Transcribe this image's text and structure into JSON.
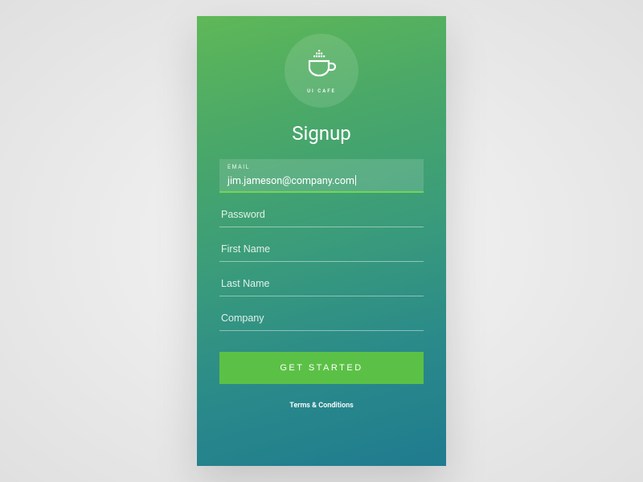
{
  "brand": "UI CAFÉ",
  "title": "Signup",
  "form": {
    "email": {
      "label": "EMAIL",
      "value": "jim.jameson@company.com"
    },
    "password": {
      "placeholder": "Password"
    },
    "first_name": {
      "placeholder": "First Name"
    },
    "last_name": {
      "placeholder": "Last Name"
    },
    "company": {
      "placeholder": "Company"
    }
  },
  "cta_label": "GET STARTED",
  "terms_label": "Terms & Conditions"
}
